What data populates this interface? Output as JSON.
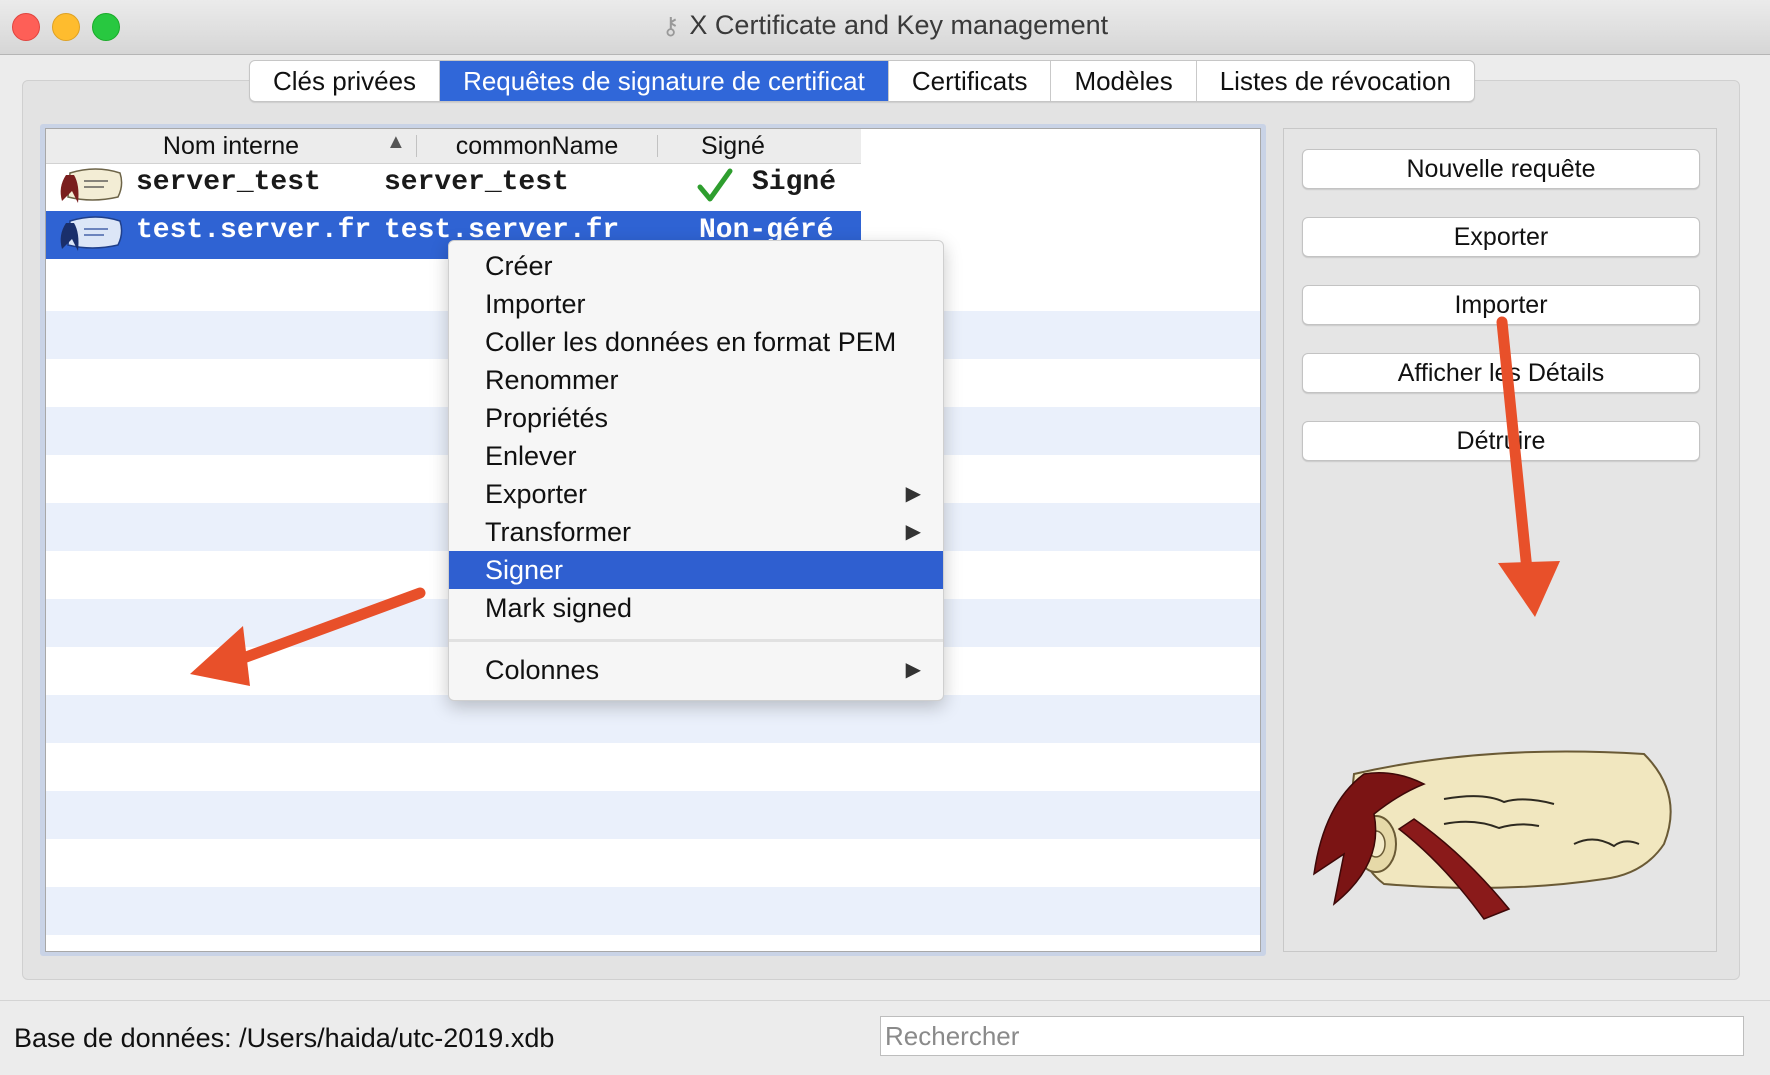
{
  "window": {
    "title": "X Certificate and Key management"
  },
  "tabs": [
    {
      "label": "Clés privées",
      "active": false
    },
    {
      "label": "Requêtes de signature de certificat",
      "active": true
    },
    {
      "label": "Certificats",
      "active": false
    },
    {
      "label": "Modèles",
      "active": false
    },
    {
      "label": "Listes de révocation",
      "active": false
    }
  ],
  "table": {
    "columns": [
      "Nom interne",
      "commonName",
      "Signé"
    ],
    "sort": {
      "column": "Nom interne",
      "direction": "ascending"
    },
    "rows": [
      {
        "internal_name": "server_test",
        "common_name": "server_test",
        "signed": "Signé",
        "signed_icon": "checkmark-icon",
        "selected": false
      },
      {
        "internal_name": "test.server.fr",
        "common_name": "test.server.fr",
        "signed": "Non-géré",
        "selected": true
      }
    ]
  },
  "context_menu": {
    "items": [
      {
        "label": "Créer"
      },
      {
        "label": "Importer"
      },
      {
        "label": "Coller les données en format PEM"
      },
      {
        "label": "Renommer"
      },
      {
        "label": "Propriétés"
      },
      {
        "label": "Enlever"
      },
      {
        "label": "Exporter",
        "submenu": true
      },
      {
        "label": "Transformer",
        "submenu": true
      },
      {
        "label": "Signer",
        "highlighted": true
      },
      {
        "label": "Mark signed"
      }
    ],
    "footer_item": {
      "label": "Colonnes",
      "submenu": true
    }
  },
  "actions": {
    "new_request": "Nouvelle requête",
    "export": "Exporter",
    "import": "Importer",
    "show_details": "Afficher les Détails",
    "destroy": "Détruire"
  },
  "status": {
    "database": "Base de données: /Users/haida/utc-2019.xdb",
    "search_placeholder": "Rechercher"
  },
  "colors": {
    "accent": "#3067d9",
    "selection": "#2f63d3",
    "row_stripe": "#eaf0fb",
    "annotation_arrow": "#e8502a"
  }
}
